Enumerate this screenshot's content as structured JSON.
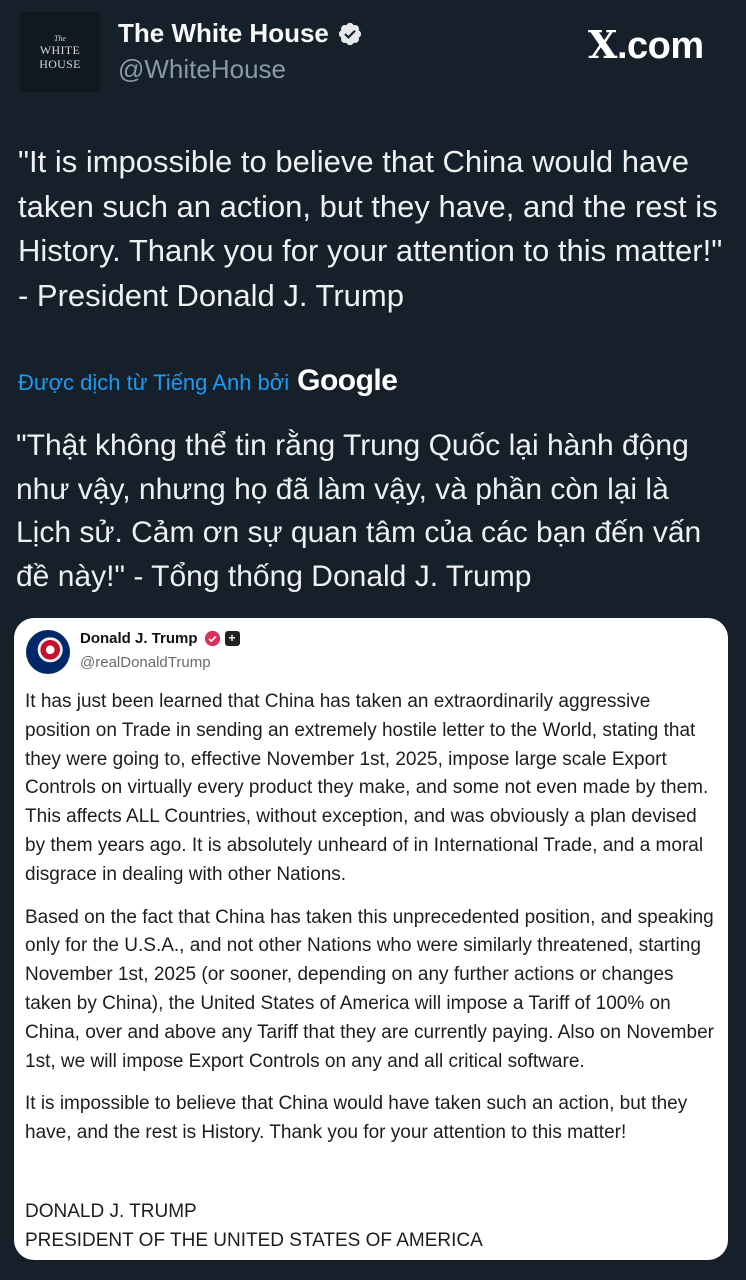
{
  "author": {
    "avatar_lines": [
      "The",
      "WHITE",
      "HOUSE"
    ],
    "display_name": "The White House",
    "handle": "@WhiteHouse",
    "verified_icon": "gold-verified-badge",
    "verified_color": "#e7e9ea"
  },
  "brand": {
    "logo_mark": "X",
    "logo_suffix": ".com"
  },
  "tweet": {
    "text": "\"It is impossible to believe that China would have taken such an action, but they have, and the rest is History. Thank you for your attention to this matter!\" - President Donald J. Trump"
  },
  "translation": {
    "label": "Được dịch từ Tiếng Anh bởi",
    "provider": "Google",
    "text": "\"Thật không thể tin rằng Trung Quốc lại hành động như vậy, nhưng họ đã làm vậy, và phần còn lại là Lịch sử. Cảm ơn sự quan tâm của các bạn đến vấn đề này!\" - Tổng thống Donald J. Trump"
  },
  "embedded_post": {
    "name": "Donald J. Trump",
    "handle": "@realDonaldTrump",
    "paragraphs": [
      "It has just been learned that China has taken an extraordinarily aggressive position on Trade in sending an extremely hostile letter to the World, stating that they were going to, effective November 1st, 2025, impose large scale Export Controls on virtually every product they make, and some not even made by them. This affects ALL Countries, without exception, and was obviously a plan devised by them years ago. It is absolutely unheard of in International Trade, and a moral disgrace in dealing with other Nations.",
      "Based on the fact that China has taken this unprecedented position, and speaking only for the U.S.A., and not other Nations who were similarly threatened, starting November 1st, 2025 (or sooner, depending on any further actions or changes taken by China), the United States of America will impose a Tariff of 100% on China, over and above any Tariff that they are currently paying. Also on November 1st, we will impose Export Controls on any and all critical software.",
      "It is impossible to believe that China would have taken such an action, but they have, and the rest is History. Thank you for your attention to this matter!"
    ],
    "signature_name": "DONALD J. TRUMP",
    "signature_title": "PRESIDENT OF THE UNITED STATES OF AMERICA"
  },
  "colors": {
    "background": "#15202b",
    "link": "#1d9bf0",
    "card_bg": "#ffffff"
  }
}
